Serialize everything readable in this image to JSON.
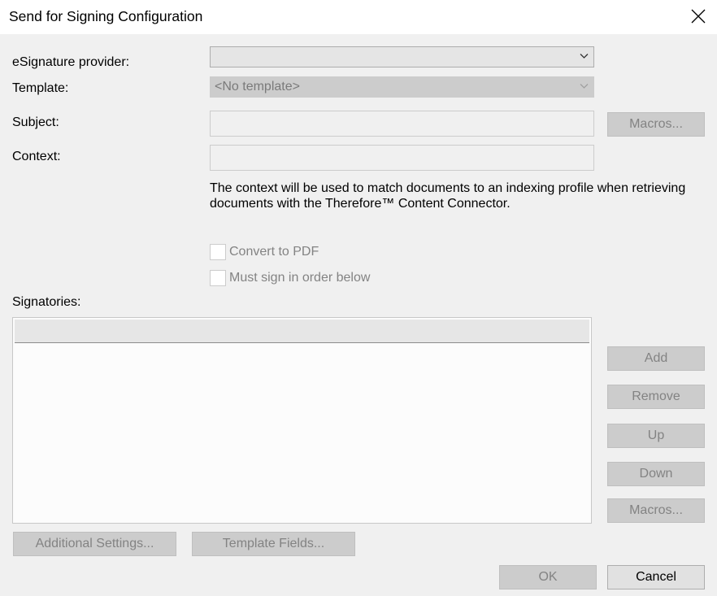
{
  "window": {
    "title": "Send for Signing Configuration"
  },
  "form": {
    "provider_label": "eSignature provider:",
    "provider_value": "",
    "template_label": "Template:",
    "template_value": "<No template>",
    "subject_label": "Subject:",
    "subject_value": "",
    "context_label": "Context:",
    "context_value": "",
    "context_description": "The context will be used to match documents to an indexing profile when retrieving documents with the Therefore™ Content Connector.",
    "convert_pdf_label": "Convert to PDF",
    "convert_pdf_checked": false,
    "sign_order_label": "Must sign in order below",
    "sign_order_checked": false,
    "signatories_label": "Signatories:"
  },
  "buttons": {
    "macros_subject": "Macros...",
    "add": "Add",
    "remove": "Remove",
    "up": "Up",
    "down": "Down",
    "macros_signatories": "Macros...",
    "additional_settings": "Additional Settings...",
    "template_fields": "Template Fields...",
    "ok": "OK",
    "cancel": "Cancel"
  },
  "icons": {
    "close": "close-icon",
    "dropdown": "chevron-down-icon"
  },
  "colors": {
    "dialog_bg": "#f0f0f0",
    "titlebar_bg": "#ffffff",
    "disabled_text": "#838383",
    "disabled_button_bg": "#cccccc"
  }
}
